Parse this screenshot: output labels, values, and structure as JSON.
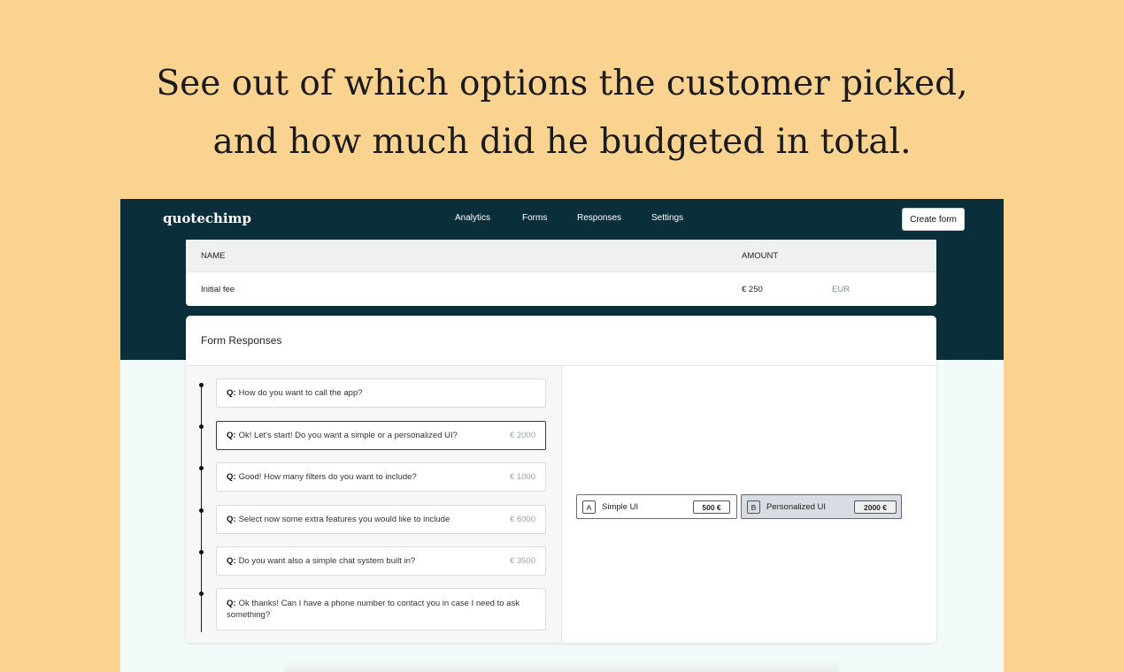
{
  "headline": {
    "line1": "See out of which options the customer picked,",
    "line2": "and how much did he budgeted in total."
  },
  "app": {
    "logo": "quotechimp",
    "nav": [
      "Analytics",
      "Forms",
      "Responses",
      "Settings"
    ],
    "create_button": "Create form"
  },
  "fees": {
    "headers": {
      "name": "NAME",
      "amount": "AMOUNT"
    },
    "rows": [
      {
        "name": "Initial fee",
        "amount": "€ 250",
        "currency": "EUR"
      }
    ]
  },
  "responses": {
    "title": "Form Responses",
    "question_prefix": "Q:",
    "questions": [
      {
        "text": "How do you want to call the app?",
        "amount": ""
      },
      {
        "text": "Ok! Let's start! Do you want a simple or a personalized UI?",
        "amount": "€ 2000"
      },
      {
        "text": "Good! How many filters do you want to include?",
        "amount": "€ 1000"
      },
      {
        "text": "Select now some extra features you would like to include",
        "amount": "€ 6000"
      },
      {
        "text": "Do you want also a simple chat system built in?",
        "amount": "€ 3500"
      },
      {
        "text": "Ok thanks! Can I have a phone number to contact you in case I need to ask something?",
        "amount": ""
      }
    ],
    "options": [
      {
        "letter": "A",
        "label": "Simple UI",
        "price": "500 €",
        "selected": false
      },
      {
        "letter": "B",
        "label": "Personalized UI",
        "price": "2000 €",
        "selected": true
      }
    ]
  }
}
